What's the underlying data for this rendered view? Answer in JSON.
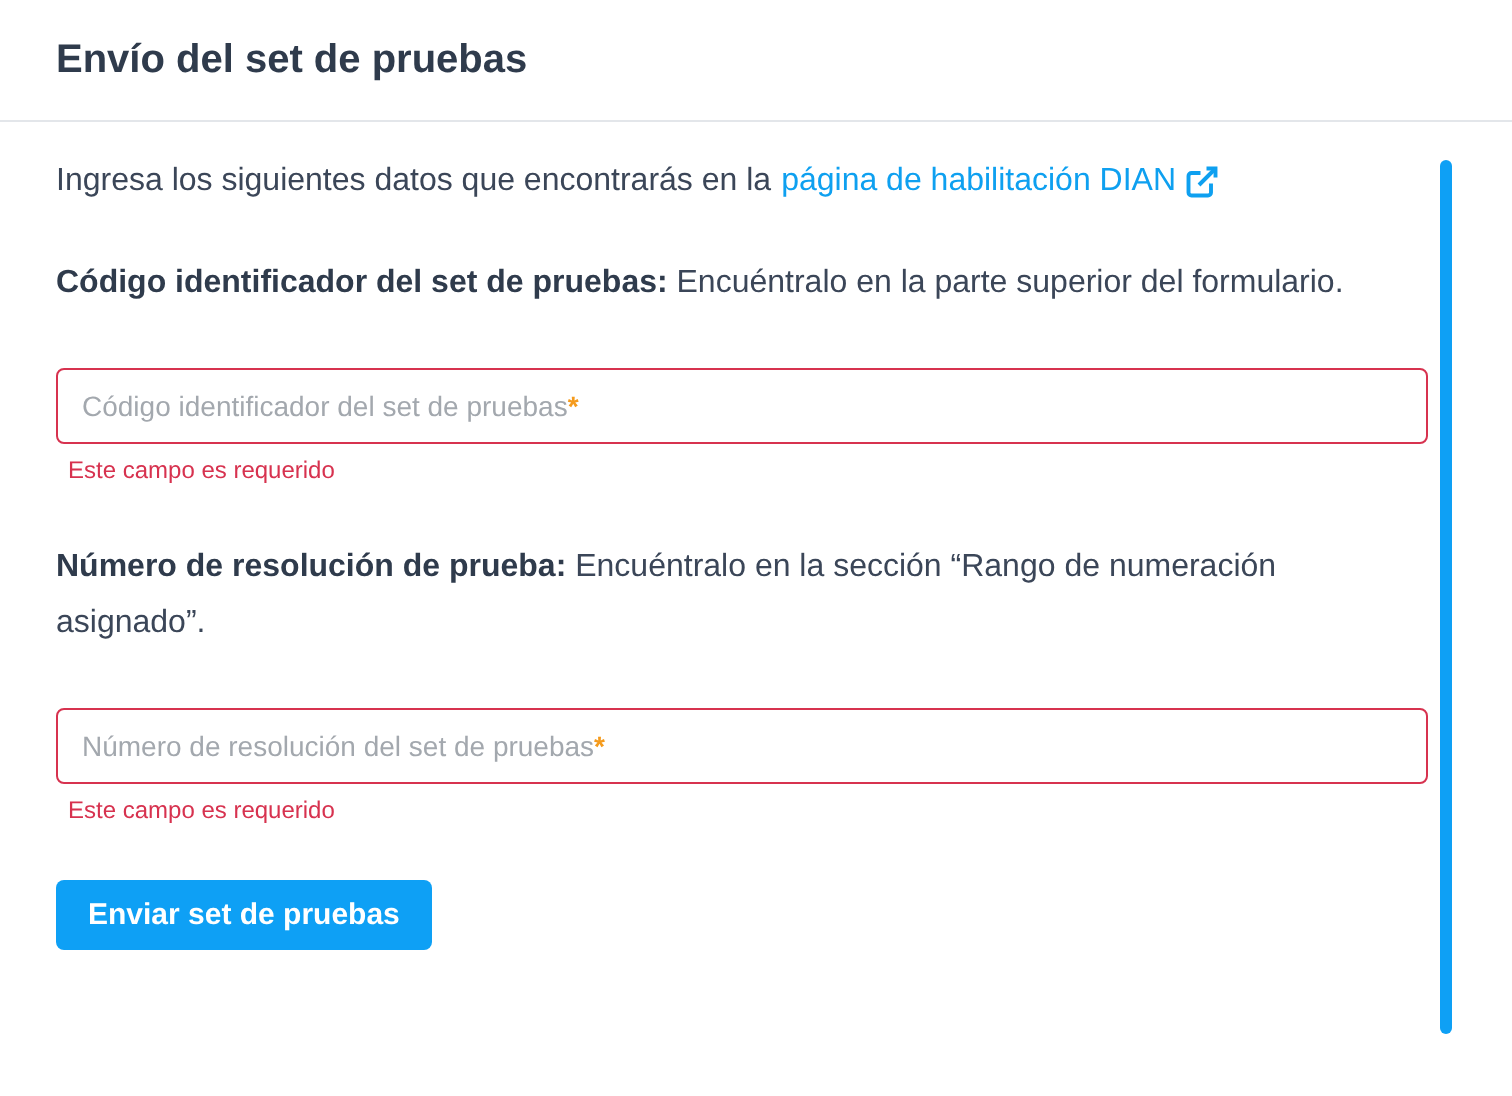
{
  "header": {
    "title": "Envío del set de pruebas"
  },
  "intro": {
    "text": "Ingresa los siguientes datos que encontrarás en la",
    "link": "página de habilitación DIAN"
  },
  "fields": [
    {
      "instruction": "**Código identificador del set de pruebas:** Encuéntralo en la parte superior del formulario.",
      "placeholder": "Código identificador del set de pruebas",
      "required_mark": "*",
      "invalid": true,
      "error": "Este campo es requerido"
    },
    {
      "instruction": "**Número de resolución de prueba:** Encuéntralo en la sección “Rango de numeración asignado”.",
      "placeholder": "Número de resolución del set de pruebas",
      "required_mark": "*",
      "invalid": true,
      "error": "Este campo es requerido"
    }
  ],
  "submit": {
    "label": "Enviar set de pruebas"
  }
}
